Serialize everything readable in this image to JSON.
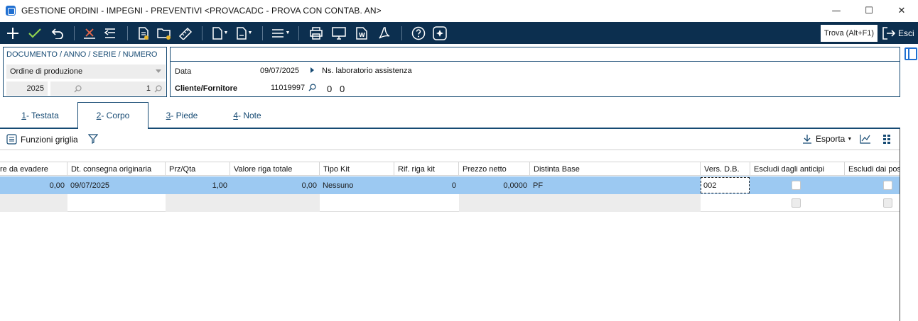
{
  "window": {
    "title": "GESTIONE ORDINI - IMPEGNI - PREVENTIVI <PROVACADC - PROVA CON CONTAB. AN>",
    "minimize": "—",
    "maximize": "☐",
    "close": "✕"
  },
  "toolbar": {
    "search_label": "Trova (Alt+F1)",
    "exit_label": "Esci"
  },
  "document": {
    "label": "DOCUMENTO / ANNO / SERIE / NUMERO",
    "type": "Ordine di produzione",
    "year": "2025",
    "number": "1"
  },
  "header": {
    "date_label": "Data",
    "date_value": "09/07/2025",
    "ns_label": "Ns. laboratorio assistenza",
    "customer_label": "Cliente/Fornitore",
    "customer_code": "11019997",
    "customer_value_1": "0",
    "customer_value_2": "0"
  },
  "tabs": [
    {
      "num": "1",
      "label": " - Testata"
    },
    {
      "num": "2",
      "label": " - Corpo"
    },
    {
      "num": "3",
      "label": " - Piede"
    },
    {
      "num": "4",
      "label": " - Note"
    }
  ],
  "grid_toolbar": {
    "functions_label": "Funzioni griglia",
    "export_label": "Esporta"
  },
  "grid": {
    "columns": [
      "re da evadere",
      "Dt. consegna originaria",
      "Prz/Qta",
      "Valore riga totale",
      "Tipo Kit",
      "Rif. riga kit",
      "Prezzo netto",
      "Distinta Base",
      "Vers. D.B.",
      "Escludi dagli anticipi",
      "Escludi dai post"
    ],
    "rows": [
      {
        "qta_evadere": "0,00",
        "dt_consegna": "09/07/2025",
        "prz_qta": "1,00",
        "valore_totale": "0,00",
        "tipo_kit": "Nessuno",
        "rif_riga_kit": "0",
        "prezzo_netto": "0,0000",
        "distinta_base": "PF",
        "vers_db": "002"
      }
    ]
  }
}
